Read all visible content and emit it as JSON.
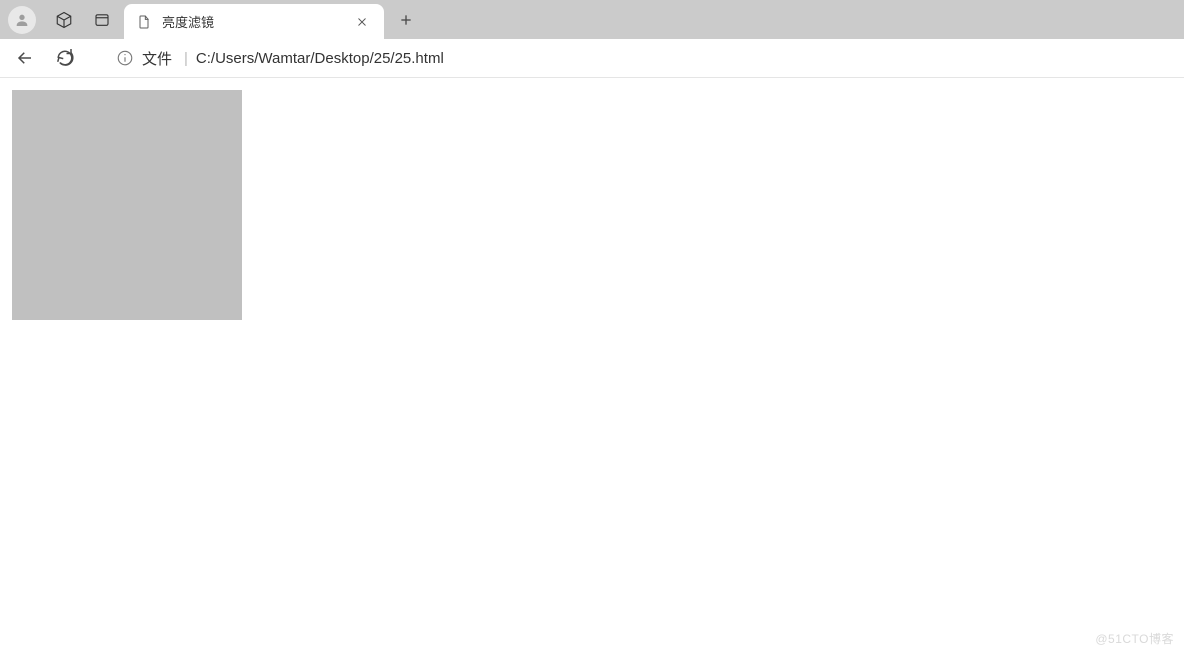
{
  "browser": {
    "tab": {
      "title": "亮度滤镜"
    },
    "addressbar": {
      "prefix": "文件",
      "divider": "|",
      "url": "C:/Users/Wamtar/Desktop/25/25.html"
    }
  },
  "watermark": "@51CTO博客"
}
